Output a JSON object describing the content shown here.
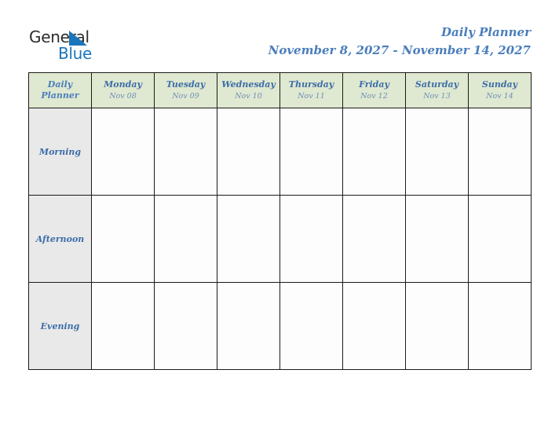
{
  "brand": {
    "word_one": "General",
    "word_two": "Blue",
    "triangle_icon": "triangle-right-icon",
    "colors": {
      "dark": "#2b2b2b",
      "blue": "#1b75bb"
    }
  },
  "header": {
    "title": "Daily Planner",
    "date_range": "November 8, 2027 - November 14, 2027"
  },
  "table": {
    "corner_label_line1": "Daily",
    "corner_label_line2": "Planner",
    "columns": [
      {
        "day": "Monday",
        "date": "Nov 08"
      },
      {
        "day": "Tuesday",
        "date": "Nov 09"
      },
      {
        "day": "Wednesday",
        "date": "Nov 10"
      },
      {
        "day": "Thursday",
        "date": "Nov 11"
      },
      {
        "day": "Friday",
        "date": "Nov 12"
      },
      {
        "day": "Saturday",
        "date": "Nov 13"
      },
      {
        "day": "Sunday",
        "date": "Nov 14"
      }
    ],
    "rows": [
      {
        "label": "Morning",
        "cells": [
          "",
          "",
          "",
          "",
          "",
          "",
          ""
        ]
      },
      {
        "label": "Afternoon",
        "cells": [
          "",
          "",
          "",
          "",
          "",
          "",
          ""
        ]
      },
      {
        "label": "Evening",
        "cells": [
          "",
          "",
          "",
          "",
          "",
          "",
          ""
        ]
      }
    ],
    "colors": {
      "header_background": "#dfe8d0",
      "label_background": "#e9e9e9",
      "cell_background": "#fdfdfd",
      "border": "#1a1a1a",
      "text_blue": "#4a7ebb",
      "text_blue_muted": "#6e8fb8"
    }
  }
}
